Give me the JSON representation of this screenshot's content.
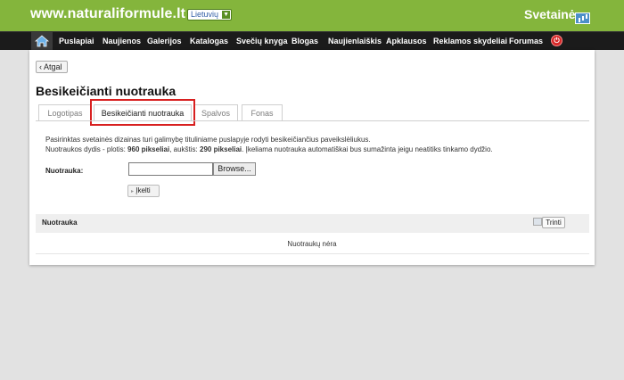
{
  "header": {
    "site_url": "www.naturaliformule.lt",
    "language": "Lietuvių",
    "brand": "Svetainė"
  },
  "nav": {
    "items": [
      "Puslapiai",
      "Naujienos",
      "Galerijos",
      "Katalogas",
      "Svečių knyga",
      "Blogas",
      "Naujienlaiškis",
      "Apklausos",
      "Reklamos skydeliai",
      "Forumas"
    ]
  },
  "page": {
    "back_label": "Atgal",
    "title": "Besikeičianti nuotrauka",
    "tabs": [
      "Logotipas",
      "Besikeičianti nuotrauka",
      "Spalvos",
      "Fonas"
    ],
    "active_tab": "Besikeičianti nuotrauka",
    "description_line1": "Pasirinktas svetainės dizainas turi galimybę tituliniame puslapyje rodyti besikeičiančius paveikslėliukus.",
    "description_line2_prefix": "Nuotraukos dydis - plotis: ",
    "width_value": "960 pikseliai",
    "description_line2_mid": ", aukštis: ",
    "height_value": "290 pikseliai",
    "description_line2_suffix": ". Įkeliama nuotrauka automatiškai bus sumažinta jeigu neatitiks tinkamo dydžio.",
    "field_label": "Nuotrauka:",
    "browse_label": "Browse...",
    "upload_label": "Įkelti"
  },
  "table": {
    "header": "Nuotrauka",
    "delete_label": "Trinti",
    "empty_text": "Nuotraukų nėra"
  },
  "colors": {
    "topbar": "#84b53c",
    "nav": "#1b1b1b",
    "highlight": "#d82020"
  }
}
